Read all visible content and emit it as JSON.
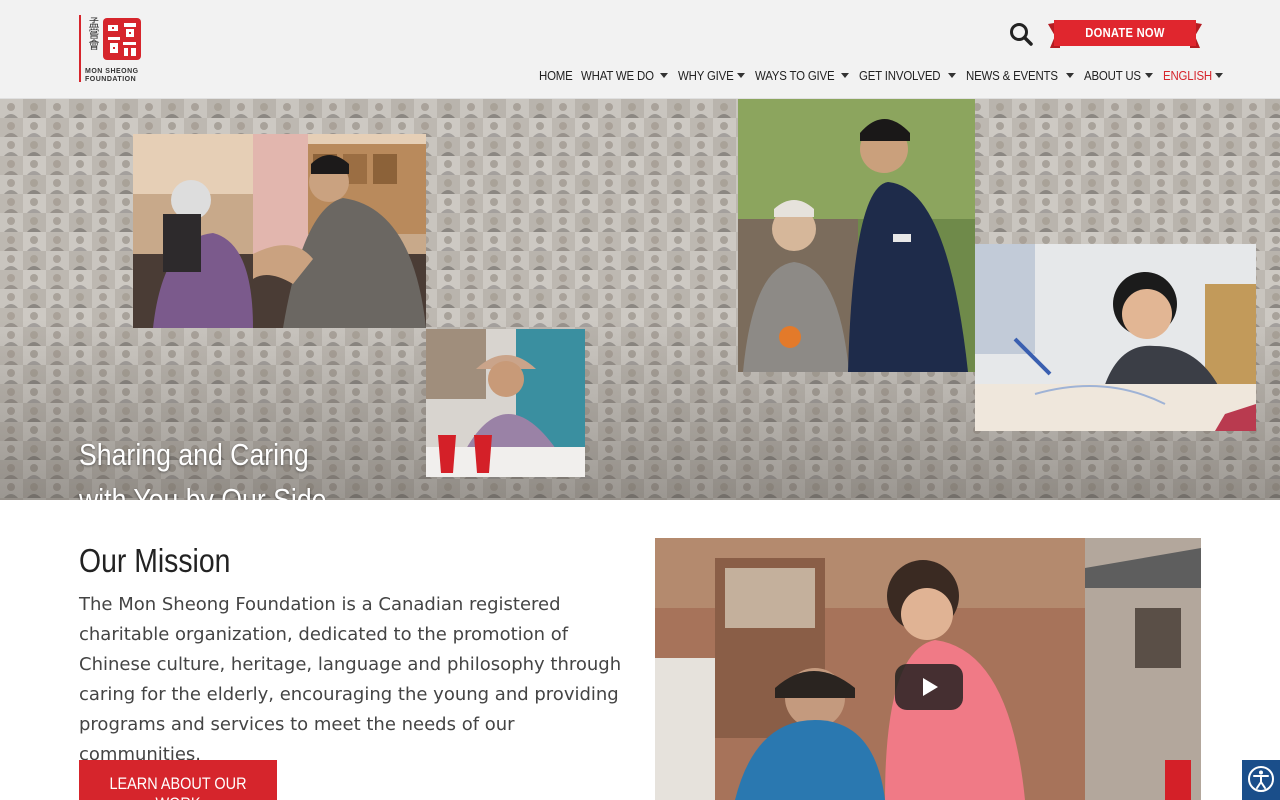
{
  "brand": {
    "name_line1": "MON SHEONG",
    "name_line2": "FOUNDATION",
    "chinese_chars": "孟嘗會"
  },
  "header": {
    "search_icon": "search-icon",
    "donate_label": "DONATE NOW"
  },
  "nav": {
    "items": [
      {
        "label": "HOME",
        "has_dropdown": false
      },
      {
        "label": "WHAT WE DO",
        "has_dropdown": true
      },
      {
        "label": "WHY GIVE",
        "has_dropdown": true
      },
      {
        "label": "WAYS TO GIVE",
        "has_dropdown": true
      },
      {
        "label": "GET INVOLVED",
        "has_dropdown": true
      },
      {
        "label": "NEWS & EVENTS",
        "has_dropdown": true
      },
      {
        "label": "ABOUT US",
        "has_dropdown": true
      },
      {
        "label": "ENGLISH",
        "has_dropdown": true
      }
    ]
  },
  "hero": {
    "heading_line1": "Sharing and Caring",
    "heading_line2": "with You by Our Side"
  },
  "mission": {
    "title": "Our Mission",
    "text": "The Mon Sheong Foundation is a Canadian registered charitable organization, dedicated to the promotion of Chinese culture, heritage, language and philosophy through caring for the elderly, encouraging the young and providing programs and services to meet the needs of our communities.",
    "button_label": "LEARN ABOUT OUR WORK"
  },
  "colors": {
    "accent": "#d6252c",
    "header_bg": "#f2f2f2",
    "a11y_bg": "#1a4e8a"
  }
}
